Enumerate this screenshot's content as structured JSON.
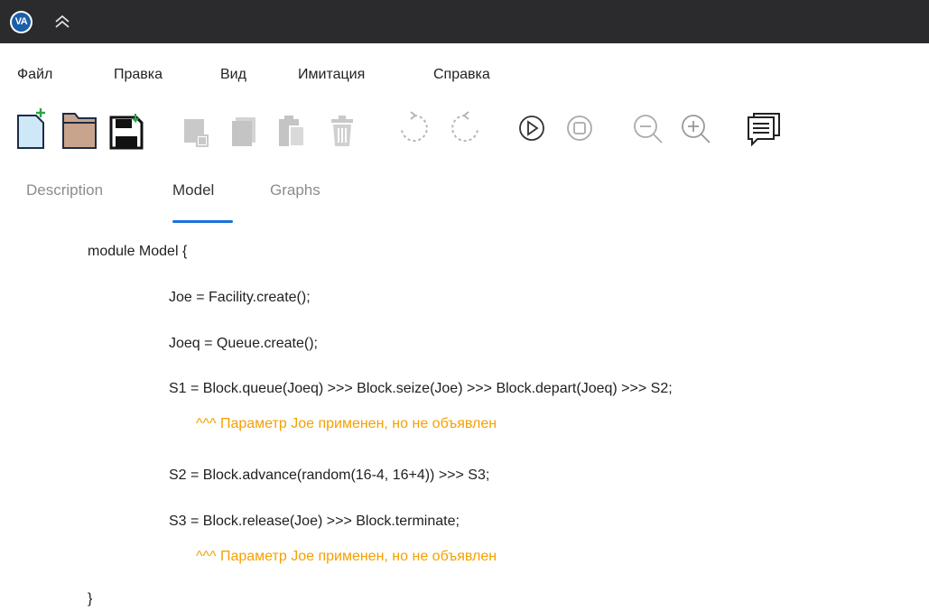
{
  "app": {
    "logo_text": "VA"
  },
  "menu": {
    "items": [
      "Файл",
      "Правка",
      "Вид",
      "Имитация",
      "Справка"
    ]
  },
  "toolbar": {
    "icons": [
      "new-file-icon",
      "open-folder-icon",
      "save-icon",
      "copy-icon",
      "duplicate-icon",
      "paste-icon",
      "delete-icon",
      "undo-icon",
      "redo-icon",
      "run-icon",
      "stop-icon",
      "zoom-out-icon",
      "zoom-in-icon",
      "messages-icon"
    ]
  },
  "tabs": {
    "items": [
      "Description",
      "Model",
      "Graphs"
    ],
    "active": "Model"
  },
  "editor": {
    "lines": [
      "module Model {",
      "Joe = Facility.create();",
      "Joeq = Queue.create();",
      "S1 = Block.queue(Joeq) >>> Block.seize(Joe) >>> Block.depart(Joeq) >>> S2;",
      "^^^ Параметр Joe применен, но не объявлен",
      "S2 = Block.advance(random(16-4, 16+4)) >>> S3;",
      "S3 = Block.release(Joe) >>> Block.terminate;",
      "^^^ Параметр Joe применен, но не объявлен",
      "}"
    ]
  },
  "colors": {
    "titlebar": "#2b2b2e",
    "accent": "#1a73d9",
    "warning": "#f5a000"
  }
}
